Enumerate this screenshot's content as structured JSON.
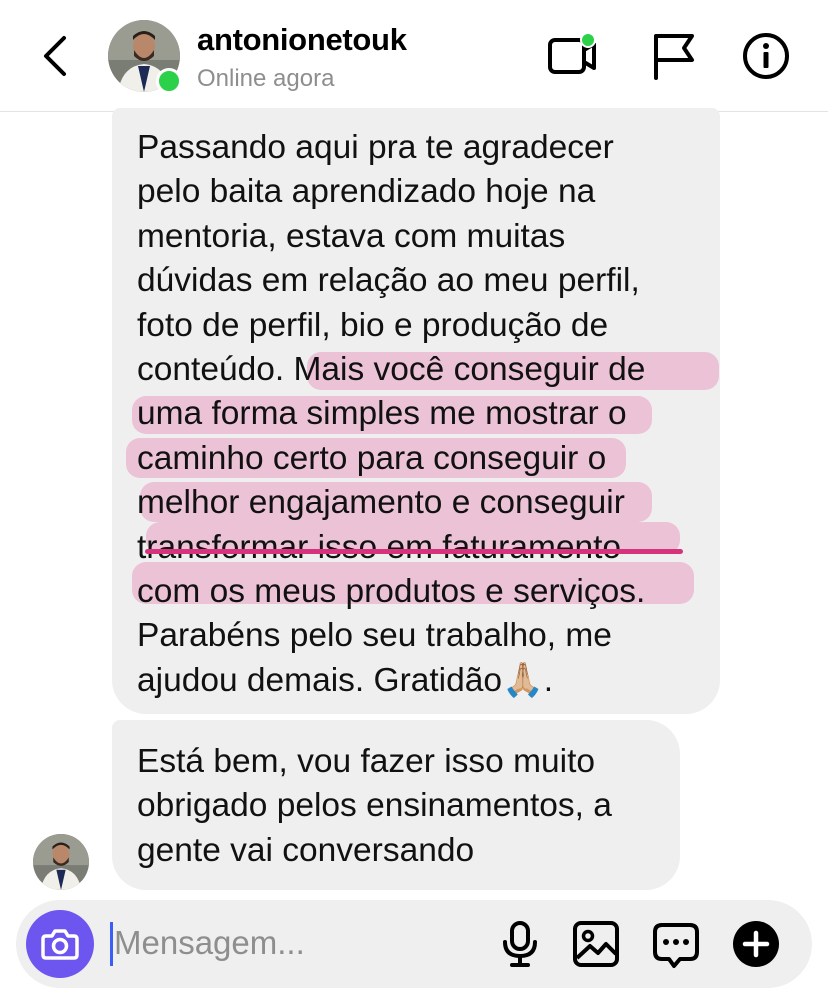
{
  "header": {
    "username": "antonionetouk",
    "status": "Online agora",
    "icons": [
      "back-chevron-icon",
      "video-call-icon",
      "flag-icon",
      "info-icon"
    ],
    "online_color": "#2ad149"
  },
  "messages": [
    {
      "sender": "contact",
      "text": "Passando aqui pra te agradecer\npelo baita aprendizado hoje na\nmentoria, estava com muitas\ndúvidas em relação ao meu perfil,\nfoto de perfil, bio e produção de\nconteúdo. Mais você conseguir de\numa forma simples me mostrar o\ncaminho certo para conseguir o\nmelhor engajamento e conseguir\ntransformar isso em faturamento\ncom os meus produtos e serviços.\nParabéns pelo seu trabalho, me\najudou demais. Gratidão🙏🏼.",
      "highlighted_text": "Mais você conseguir de uma forma simples me mostrar o caminho certo para conseguir o melhor engajamento e conseguir transformar isso em faturamento com os meus produtos e serviços.",
      "highlight_color": "#e886b2",
      "underline_color": "#d6337c"
    },
    {
      "sender": "contact",
      "text": "Está bem, vou fazer isso muito\nobrigado pelos ensinamentos, a\ngente vai conversando"
    }
  ],
  "composer": {
    "placeholder": "Mensagem...",
    "camera_color": "#6d55f0",
    "icons": [
      "camera-icon",
      "microphone-icon",
      "gallery-icon",
      "sticker-icon",
      "plus-icon"
    ]
  }
}
